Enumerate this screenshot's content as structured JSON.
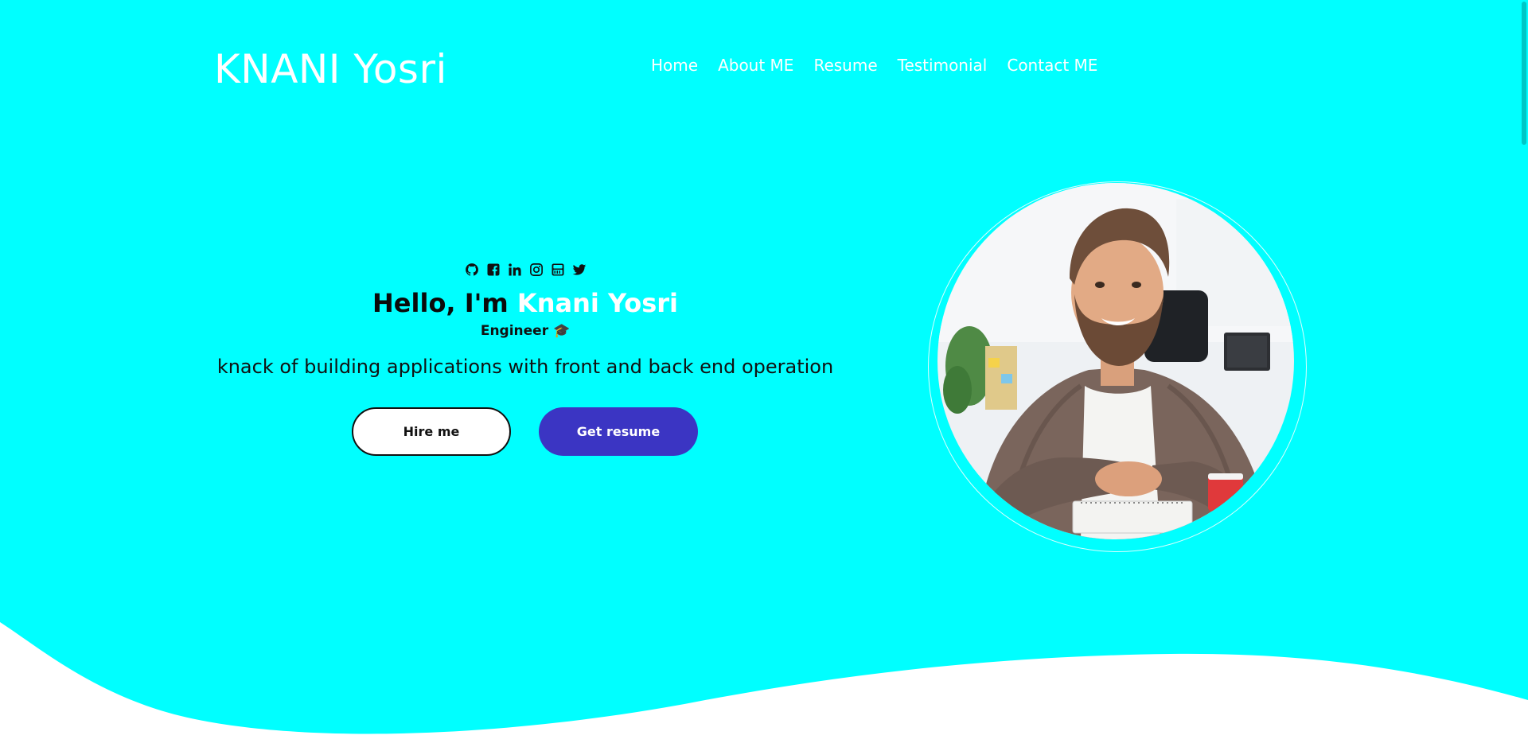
{
  "colors": {
    "hero_bg": "#00ffff",
    "accent_button": "#3b35c3",
    "name_highlight": "#ffffff"
  },
  "header": {
    "logo": "KNANI Yosri",
    "nav": [
      "Home",
      "About ME",
      "Resume",
      "Testimonial",
      "Contact ME"
    ]
  },
  "hero": {
    "social_icons": [
      "github-icon",
      "facebook-icon",
      "linkedin-icon",
      "instagram-icon",
      "youtube-icon",
      "twitter-icon"
    ],
    "greeting_prefix": "Hello, I'm",
    "greeting_name": "Knani Yosri",
    "role": "Engineer 🎓",
    "tagline": "knack of building applications with front and back end operation",
    "buttons": {
      "hire": "Hire me",
      "resume": "Get resume"
    }
  }
}
